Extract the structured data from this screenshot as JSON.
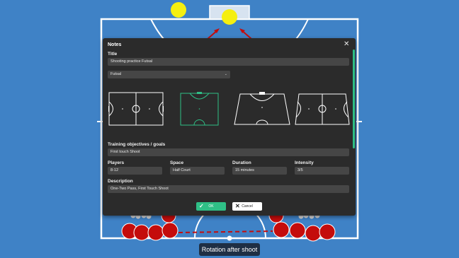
{
  "dialog": {
    "title": "Notes",
    "title_label": "Title",
    "title_value": "Shooting practice Futsal",
    "sport_selected": "Futsal",
    "objectives_label": "Training objectives / goals",
    "objectives_value": "First touch Shoot",
    "players_label": "Players",
    "players_value": "8-12",
    "space_label": "Space",
    "space_value": "Half Court",
    "duration_label": "Duration",
    "duration_value": "15 minutes",
    "intensity_label": "Intensity",
    "intensity_value": "3/5",
    "description_label": "Description",
    "description_value": "One-Two Pass, First Touch Shoot",
    "ok_label": "OK",
    "cancel_label": "Cancel"
  },
  "caption": "Rotation after shoot",
  "colors": {
    "background": "#3f82c6",
    "dialog": "#2b2b2b",
    "field": "#464646",
    "accent": "#2fbf86",
    "ball": "#f5ef10",
    "player": "#c40c0c"
  },
  "icons": [
    "close-icon",
    "chevron-down-icon",
    "check-icon",
    "x-icon"
  ]
}
